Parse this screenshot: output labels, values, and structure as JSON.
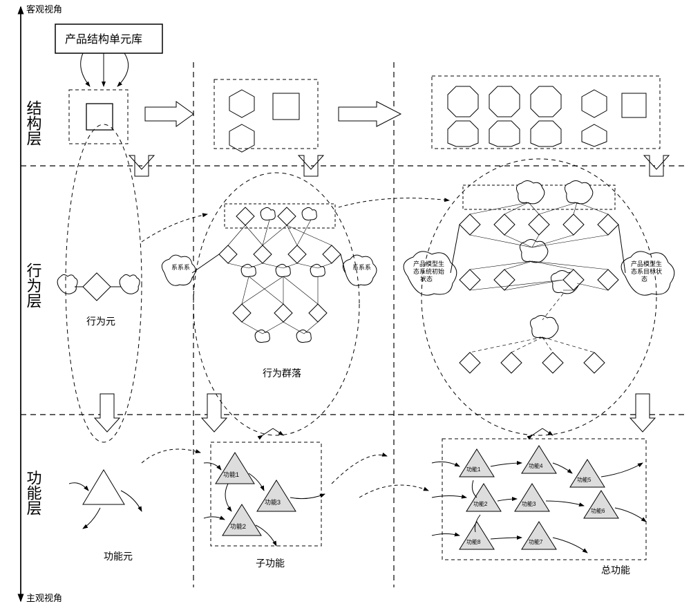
{
  "axis_top": "客观视角",
  "axis_bottom": "主观视角",
  "unit_library": "产品结构单元库",
  "layer1": "结构层",
  "layer2": "行为层",
  "layer3": "功能层",
  "col1_row2": "行为元",
  "col1_row3": "功能元",
  "col2_row2": "行为群落",
  "col2_row3": "子功能",
  "col3_row3": "总功能",
  "xixi1": "系系系",
  "xixi2": "系系系",
  "eco_initial": "产品模型生态系统初始状态",
  "eco_target": "产品模型生态系目标状态",
  "func1": "功能1",
  "func2": "功能2",
  "func3": "功能3",
  "func4": "功能4",
  "func5": "功能5",
  "func6": "功能6",
  "func7": "功能7",
  "func8": "功能8"
}
